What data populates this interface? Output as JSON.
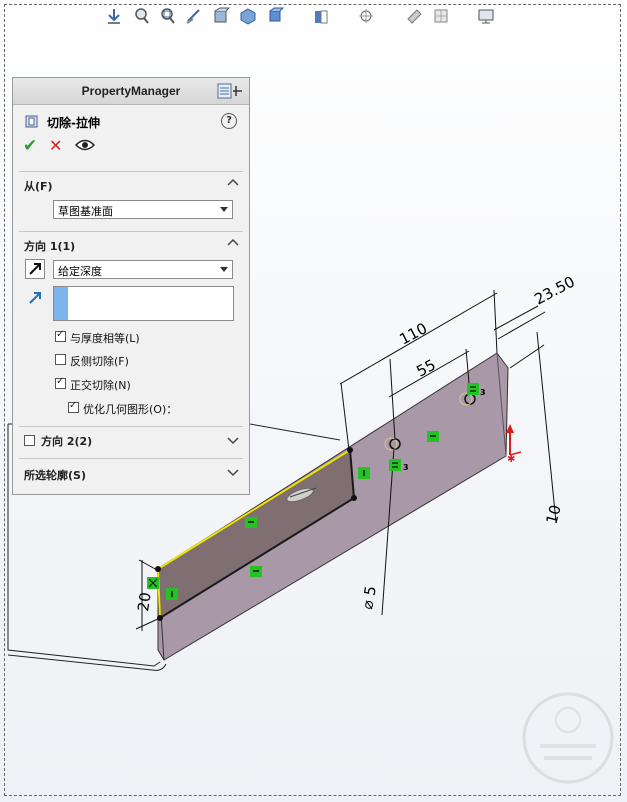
{
  "toolbar": {
    "icons": [
      "view-orientation-icon",
      "zoom-to-fit-icon",
      "zoom-area-icon",
      "previous-view-icon",
      "section-view-icon",
      "view-selector-icon",
      "display-style-icon",
      "hide-show-icon",
      "edit-appearance-icon",
      "apply-scene-icon",
      "view-settings-icon",
      "display-manager-icon"
    ]
  },
  "pm": {
    "header_title": "PropertyManager",
    "feature_name": "切除-拉伸",
    "help": "?",
    "from": {
      "title": "从(F)",
      "value": "草图基准面"
    },
    "direction1": {
      "title": "方向 1(1)",
      "end_condition": "给定深度",
      "depth_value": "",
      "link_thickness_label": "与厚度相等(L)",
      "link_thickness_checked": true,
      "flip_side_label": "反侧切除(F)",
      "flip_side_checked": false,
      "normal_cut_label": "正交切除(N)",
      "normal_cut_checked": true,
      "optimize_label": "优化几何图形(O)：",
      "optimize_checked": true
    },
    "direction2": {
      "title": "方向 2(2)",
      "checked": false
    },
    "selected_contours": {
      "title": "所选轮廓(S)"
    }
  },
  "dimensions": {
    "d110": "110",
    "d55": "55",
    "d2350": "23.50",
    "d10": "10",
    "d20": "20",
    "dia5": "⌀ 5",
    "rel3a": "3",
    "rel3b": "3"
  },
  "colors": {
    "accent_green": "#2aa12a",
    "cancel_red": "#d62424",
    "part_face": "#a898a8",
    "sketch_region": "#7f6f72",
    "relation_green": "#22c322",
    "underline_red": "#d62424"
  }
}
